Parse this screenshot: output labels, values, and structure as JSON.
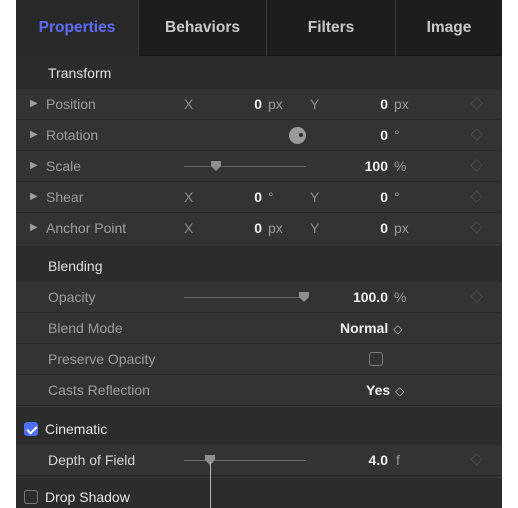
{
  "tabs": [
    "Properties",
    "Behaviors",
    "Filters",
    "Image"
  ],
  "active_tab": "Properties",
  "colors": {
    "accent": "#5d6cf6",
    "checkbox_on": "#4d6ef5",
    "panel_bg": "#2c2c2c",
    "row_bg": "#333333"
  },
  "transform": {
    "title": "Transform",
    "position": {
      "label": "Position",
      "x_axis": "X",
      "x_value": "0",
      "x_unit": "px",
      "y_axis": "Y",
      "y_value": "0",
      "y_unit": "px"
    },
    "rotation": {
      "label": "Rotation",
      "value": "0",
      "unit": "°"
    },
    "scale": {
      "label": "Scale",
      "value": "100",
      "unit": "%"
    },
    "shear": {
      "label": "Shear",
      "x_axis": "X",
      "x_value": "0",
      "x_unit": "°",
      "y_axis": "Y",
      "y_value": "0",
      "y_unit": "°"
    },
    "anchor_point": {
      "label": "Anchor Point",
      "x_axis": "X",
      "x_value": "0",
      "x_unit": "px",
      "y_axis": "Y",
      "y_value": "0",
      "y_unit": "px"
    }
  },
  "blending": {
    "title": "Blending",
    "opacity": {
      "label": "Opacity",
      "value": "100.0",
      "unit": "%"
    },
    "blend_mode": {
      "label": "Blend Mode",
      "value": "Normal"
    },
    "preserve_opacity": {
      "label": "Preserve Opacity",
      "checked": false
    },
    "casts_reflection": {
      "label": "Casts Reflection",
      "value": "Yes"
    }
  },
  "cinematic": {
    "label": "Cinematic",
    "checked": true,
    "depth_of_field": {
      "label": "Depth of Field",
      "value": "4.0",
      "unit": "f"
    }
  },
  "drop_shadow": {
    "label": "Drop Shadow",
    "checked": false
  },
  "icons": {
    "disclosure": "disclosure-triangle-icon",
    "keyframe": "keyframe-diamond-icon",
    "stepper": "popup-chevron-icon"
  }
}
